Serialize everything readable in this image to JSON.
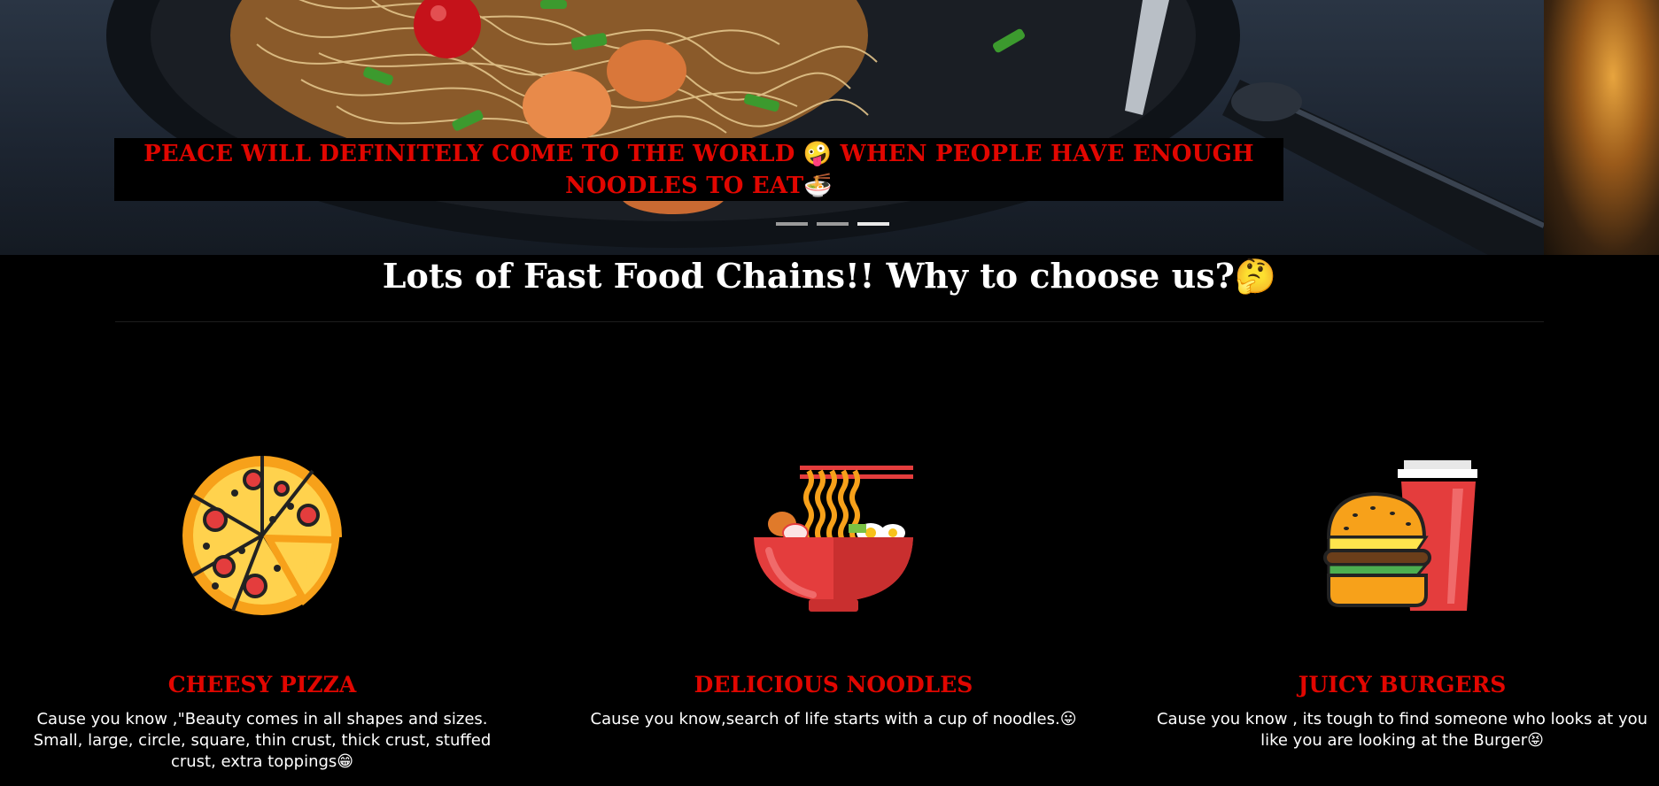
{
  "hero": {
    "caption_part1": "PEACE WILL DEFINITELY COME TO THE WORLD 🤪",
    "caption_part2": "WHEN PEOPLE HAVE ENOUGH NOODLES TO EAT🍜",
    "indicators": [
      {
        "state": "inactive"
      },
      {
        "state": "inactive"
      },
      {
        "state": "active"
      }
    ]
  },
  "section": {
    "heading": "Lots of Fast Food Chains!! Why to choose us?🤔"
  },
  "features": [
    {
      "icon": "pizza-icon",
      "title": "CHEESY PIZZA",
      "description": "Cause you know ,\"Beauty comes in all shapes and sizes. Small, large, circle, square, thin crust, thick crust, stuffed crust, extra toppings😁"
    },
    {
      "icon": "noodle-bowl-icon",
      "title": "DELICIOUS NOODLES",
      "description": "Cause you know,search of life starts with a cup of noodles.😛"
    },
    {
      "icon": "burger-icon",
      "title": "JUICY BURGERS",
      "description": "Cause you know , its tough to find someone who looks at you like you are looking at the Burger😝"
    }
  ],
  "colors": {
    "background": "#000000",
    "accent_red": "#e10600",
    "heading_white": "#ffffff"
  }
}
